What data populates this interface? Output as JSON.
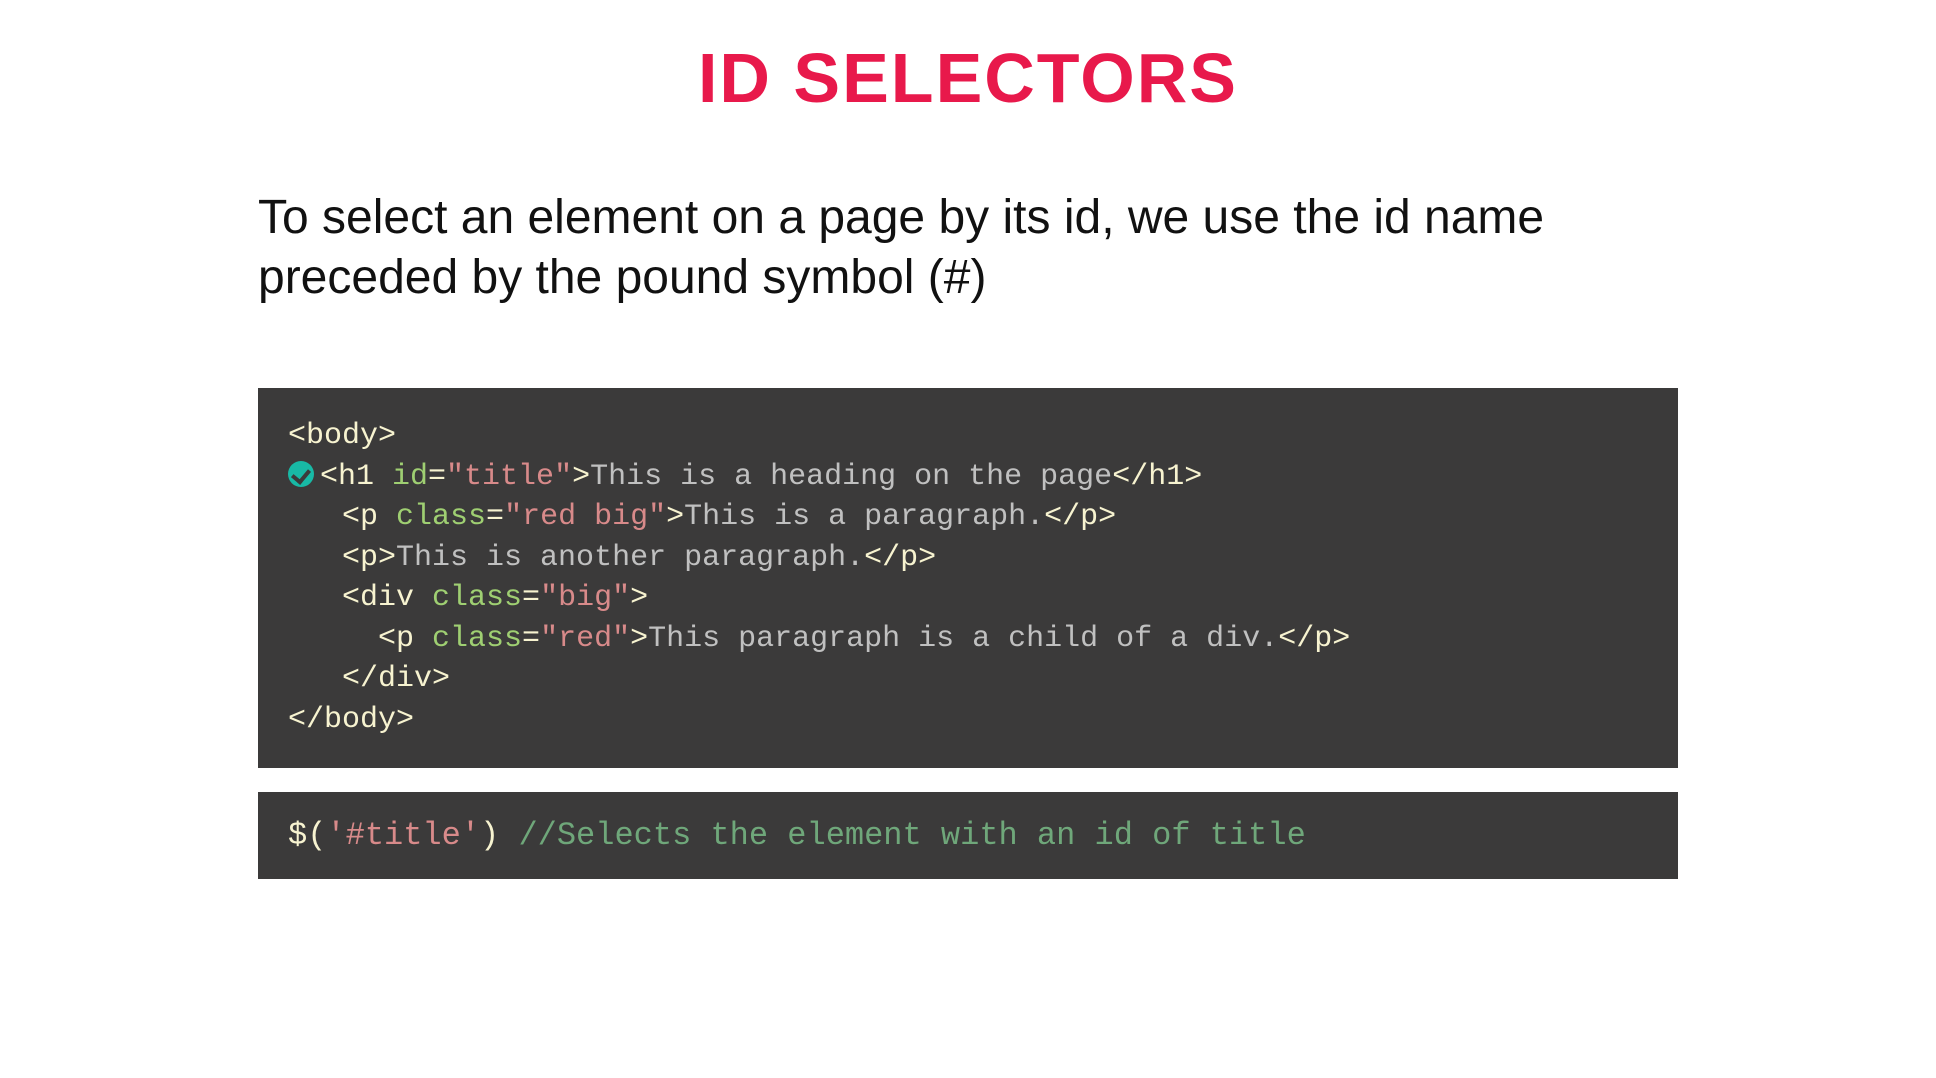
{
  "title": "ID SELECTORS",
  "description": "To select an element on a page by its id, we use the id name preceded by the pound symbol (#)",
  "code1": {
    "lines": [
      {
        "indent": "",
        "marker": false,
        "tokens": [
          {
            "t": "<body>",
            "c": "tok-tag"
          }
        ]
      },
      {
        "indent": " ",
        "marker": true,
        "tokens": [
          {
            "t": "<h1 ",
            "c": "tok-tag"
          },
          {
            "t": "id",
            "c": "tok-attr"
          },
          {
            "t": "=",
            "c": "tok-tag"
          },
          {
            "t": "\"title\"",
            "c": "tok-string"
          },
          {
            "t": ">",
            "c": "tok-tag"
          },
          {
            "t": "This is a heading on the page",
            "c": "tok-text"
          },
          {
            "t": "</h1>",
            "c": "tok-tag"
          }
        ]
      },
      {
        "indent": "   ",
        "marker": false,
        "tokens": [
          {
            "t": "<p ",
            "c": "tok-tag"
          },
          {
            "t": "class",
            "c": "tok-attr"
          },
          {
            "t": "=",
            "c": "tok-tag"
          },
          {
            "t": "\"red big\"",
            "c": "tok-string"
          },
          {
            "t": ">",
            "c": "tok-tag"
          },
          {
            "t": "This is a paragraph.",
            "c": "tok-text"
          },
          {
            "t": "</p>",
            "c": "tok-tag"
          }
        ]
      },
      {
        "indent": "   ",
        "marker": false,
        "tokens": [
          {
            "t": "<p>",
            "c": "tok-tag"
          },
          {
            "t": "This is another paragraph.",
            "c": "tok-text"
          },
          {
            "t": "</p>",
            "c": "tok-tag"
          }
        ]
      },
      {
        "indent": "   ",
        "marker": false,
        "tokens": [
          {
            "t": "<div ",
            "c": "tok-tag"
          },
          {
            "t": "class",
            "c": "tok-attr"
          },
          {
            "t": "=",
            "c": "tok-tag"
          },
          {
            "t": "\"big\"",
            "c": "tok-string"
          },
          {
            "t": ">",
            "c": "tok-tag"
          }
        ]
      },
      {
        "indent": "     ",
        "marker": false,
        "tokens": [
          {
            "t": "<p ",
            "c": "tok-tag"
          },
          {
            "t": "class",
            "c": "tok-attr"
          },
          {
            "t": "=",
            "c": "tok-tag"
          },
          {
            "t": "\"red\"",
            "c": "tok-string"
          },
          {
            "t": ">",
            "c": "tok-tag"
          },
          {
            "t": "This paragraph is a child of a div.",
            "c": "tok-text"
          },
          {
            "t": "</p>",
            "c": "tok-tag"
          }
        ]
      },
      {
        "indent": "   ",
        "marker": false,
        "tokens": [
          {
            "t": "</div>",
            "c": "tok-tag"
          }
        ]
      },
      {
        "indent": "",
        "marker": false,
        "tokens": [
          {
            "t": "</body>",
            "c": "tok-tag"
          }
        ]
      }
    ]
  },
  "code2": {
    "tokens": [
      {
        "t": "$(",
        "c": "tok-func"
      },
      {
        "t": "'#title'",
        "c": "tok-arg"
      },
      {
        "t": ") ",
        "c": "tok-func"
      },
      {
        "t": "//Selects the element with an id of title",
        "c": "tok-comment"
      }
    ]
  }
}
